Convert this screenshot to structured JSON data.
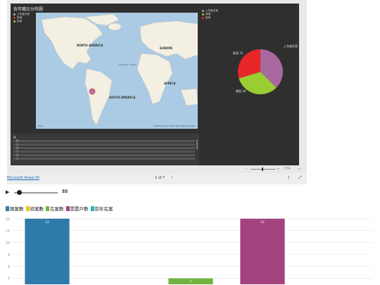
{
  "report": {
    "map_title": "各年職災分布圖",
    "map_legend": [
      {
        "label": "上年度在案",
        "color": "#a9a9a9"
      },
      {
        "label": "新增",
        "color": "#e8262a"
      },
      {
        "label": "結案",
        "color": "#9acd32"
      }
    ],
    "pie_legend": [
      {
        "label": "上年度在案",
        "color": "#a9a9a9"
      },
      {
        "label": "新增",
        "color": "#9acd32"
      },
      {
        "label": "結案",
        "color": "#e8262a"
      }
    ],
    "continents": [
      "NORTH AMERICA",
      "EUROPE",
      "AFRICA",
      "SOUTH AMERICA"
    ],
    "ocean": "Atlantic\nOcean",
    "bing": "Bing",
    "map_credit": "©2023 TomTom, ©2023 Microsoft Corporation",
    "pie": {
      "slices": [
        {
          "label": "上年度在案",
          "value": 39,
          "color": "#a8699e"
        },
        {
          "label": "閉案",
          "value": 34,
          "color": "#9acd32"
        },
        {
          "label": "結案",
          "value": 31,
          "color": "#e8262a"
        }
      ]
    },
    "table_rows": [
      "甲",
      "乙",
      "丙",
      "丁",
      "戊",
      "己"
    ]
  },
  "footer": {
    "zoom": "77%",
    "powerbi_link": "Microsoft Power BI",
    "page_indicator": "1 of 7"
  },
  "player": {
    "year": "55"
  },
  "chart_data": {
    "type": "bar",
    "series_legend": [
      {
        "name": "閉案數",
        "color": "#2e7aa8"
      },
      {
        "name": "結案數",
        "color": "#f0c419"
      },
      {
        "name": "在案數",
        "color": "#6fb43f"
      },
      {
        "name": "閒置戶數",
        "color": "#a3447f"
      },
      {
        "name": "前年在案",
        "color": "#2bb5b0"
      }
    ],
    "categories": [
      "閉案數",
      "結案數",
      "在案數",
      "閒置戶數",
      "前年在案"
    ],
    "values": [
      12,
      0,
      7,
      12,
      0
    ],
    "colors": [
      "#2e7aa8",
      "#f0c419",
      "#6fb43f",
      "#a3447f",
      "#2bb5b0"
    ],
    "y_ticks": [
      7,
      8,
      9,
      10,
      11,
      12
    ],
    "ylim": [
      6.5,
      12.4
    ],
    "grid": true
  }
}
